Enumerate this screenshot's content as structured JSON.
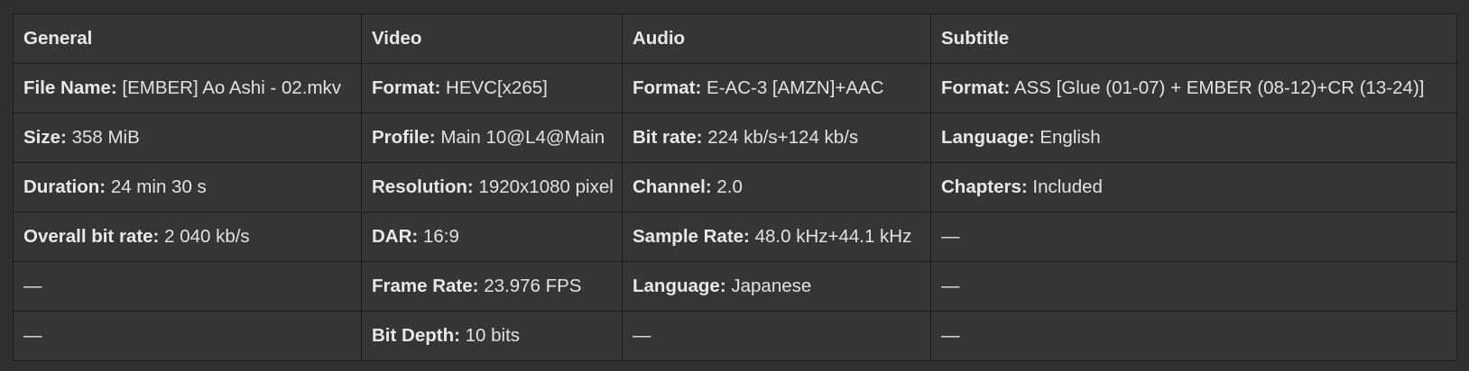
{
  "headers": [
    "General",
    "Video",
    "Audio",
    "Subtitle"
  ],
  "rows": [
    [
      {
        "k": "File Name:",
        "v": "[EMBER] Ao Ashi - 02.mkv"
      },
      {
        "k": "Format:",
        "v": "HEVC[x265]"
      },
      {
        "k": "Format:",
        "v": "E-AC-3 [AMZN]+AAC"
      },
      {
        "k": "Format:",
        "v": "ASS [Glue (01-07) + EMBER (08-12)+CR (13-24)]"
      }
    ],
    [
      {
        "k": "Size:",
        "v": "358 MiB"
      },
      {
        "k": "Profile:",
        "v": "Main 10@L4@Main"
      },
      {
        "k": "Bit rate:",
        "v": "224 kb/s+124 kb/s"
      },
      {
        "k": "Language:",
        "v": "English"
      }
    ],
    [
      {
        "k": "Duration:",
        "v": "24 min 30 s"
      },
      {
        "k": "Resolution:",
        "v": "1920x1080 pixel"
      },
      {
        "k": "Channel:",
        "v": "2.0"
      },
      {
        "k": "Chapters:",
        "v": "Included"
      }
    ],
    [
      {
        "k": "Overall bit rate:",
        "v": "2 040 kb/s"
      },
      {
        "k": "DAR:",
        "v": "16:9"
      },
      {
        "k": "Sample Rate:",
        "v": "48.0 kHz+44.1 kHz"
      },
      {
        "k": "",
        "v": "—"
      }
    ],
    [
      {
        "k": "",
        "v": "—"
      },
      {
        "k": "Frame Rate:",
        "v": "23.976 FPS"
      },
      {
        "k": "Language:",
        "v": "Japanese"
      },
      {
        "k": "",
        "v": "—"
      }
    ],
    [
      {
        "k": "",
        "v": "—"
      },
      {
        "k": "Bit Depth:",
        "v": "10 bits"
      },
      {
        "k": "",
        "v": "—"
      },
      {
        "k": "",
        "v": "—"
      }
    ]
  ]
}
